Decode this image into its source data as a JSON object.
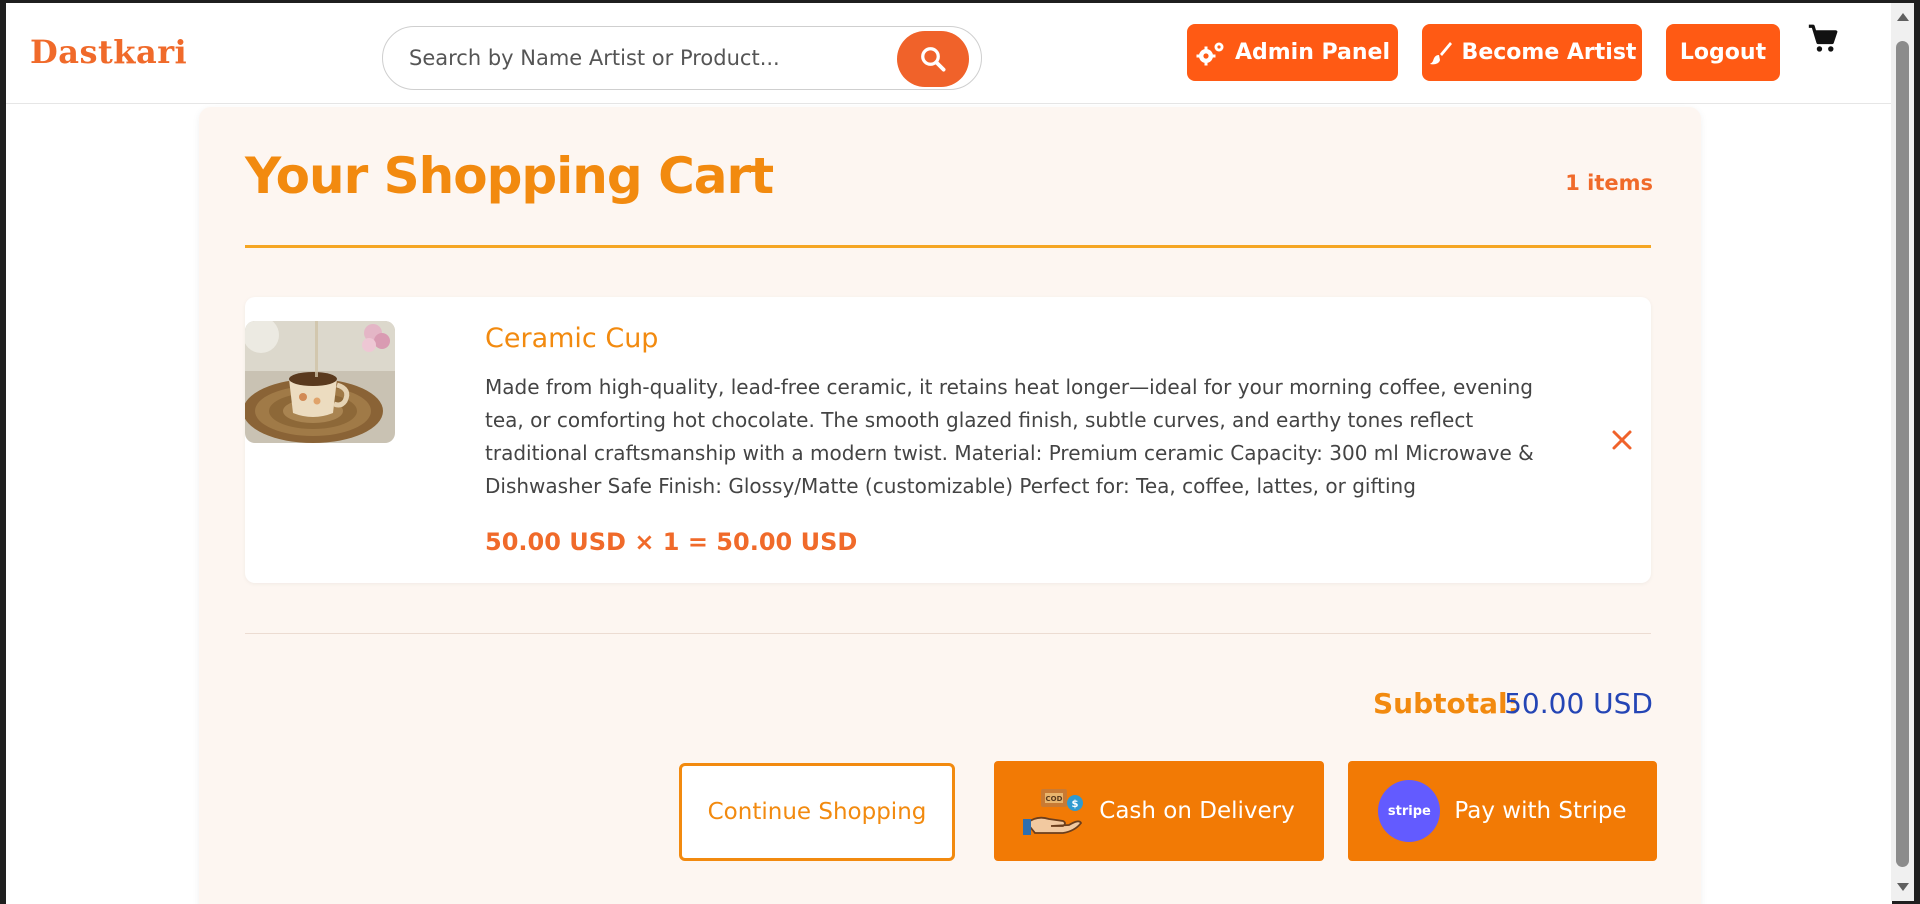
{
  "header": {
    "logo": "Dastkari",
    "search_placeholder": "Search by Name Artist or Product...",
    "admin_label": "Admin Panel",
    "artist_label": "Become Artist",
    "logout_label": "Logout"
  },
  "cart": {
    "title": "Your Shopping Cart",
    "count": "1 items",
    "items": [
      {
        "name": "Ceramic Cup",
        "description": "Made from high-quality, lead-free ceramic, it retains heat longer—ideal for your morning coffee, evening tea, or comforting hot chocolate. The smooth glazed finish, subtle curves, and earthy tones reflect traditional craftsmanship with a modern twist. Material: Premium ceramic Capacity: 300 ml Microwave & Dishwasher Safe Finish: Glossy/Matte (customizable) Perfect for: Tea, coffee, lattes, or gifting",
        "price_line": "50.00 USD × 1 = 50.00 USD"
      }
    ],
    "subtotal_label": "Subtotal:",
    "subtotal_value": "50.00 USD",
    "continue_label": "Continue Shopping",
    "cod_label": "Cash on Delivery",
    "stripe_label": "Pay with Stripe",
    "stripe_logo": "stripe"
  },
  "colors": {
    "accent": "#f28a0f",
    "brand": "#f06a2a",
    "subtotal": "#2445b5"
  },
  "icons": [
    "search-icon",
    "gears-icon",
    "brush-icon",
    "cart-icon",
    "close-icon",
    "cash-hand-icon",
    "stripe-logo"
  ]
}
